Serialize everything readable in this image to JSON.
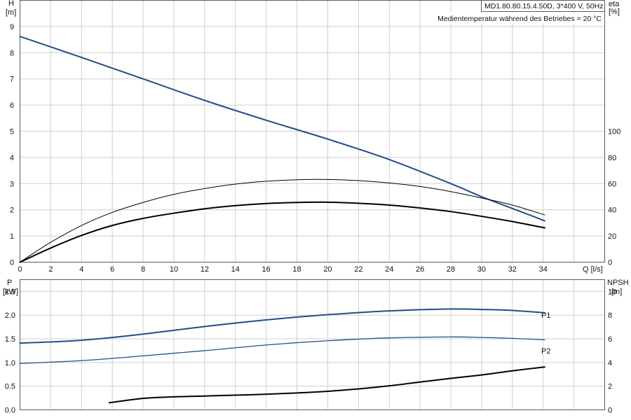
{
  "info": {
    "model_line": "MD1.80.80.15.4.50D, 3*400 V, 50Hz",
    "temp_line": "Medientemperatur während des Betriebes = 20 °C"
  },
  "colors": {
    "blue": "#1f4e8c",
    "black": "#000000",
    "grid": "#cfcfcf"
  },
  "chart_data": [
    {
      "type": "line",
      "name": "performance",
      "x_axis": {
        "label": "Q [l/s]",
        "range": [
          0,
          38
        ],
        "ticks": [
          0,
          2,
          4,
          6,
          8,
          10,
          12,
          14,
          16,
          18,
          20,
          22,
          24,
          26,
          28,
          30,
          32,
          34
        ]
      },
      "y_left": {
        "label": "H",
        "unit": "[m]",
        "range": [
          0,
          10
        ],
        "ticks": [
          0,
          1,
          2,
          3,
          4,
          5,
          6,
          7,
          8,
          9
        ]
      },
      "y_right": {
        "label": "eta",
        "unit": "[%]",
        "range": [
          0,
          200
        ],
        "ticks": [
          0,
          20,
          40,
          60,
          80,
          100
        ]
      },
      "grid": true,
      "series": [
        {
          "id": "H",
          "axis": "left",
          "color": "#1f4e8c",
          "width": 2,
          "x": [
            0,
            4,
            8,
            12,
            16,
            20,
            24,
            28,
            30,
            32,
            34.1
          ],
          "y": [
            8.62,
            7.82,
            7.0,
            6.18,
            5.42,
            4.7,
            3.92,
            3.0,
            2.5,
            2.05,
            1.58
          ]
        },
        {
          "id": "eta_thin",
          "axis": "right",
          "color": "#000000",
          "width": 1,
          "x": [
            0,
            2,
            4,
            6,
            8,
            10,
            12,
            14,
            16,
            18,
            20,
            22,
            24,
            26,
            28,
            30,
            32,
            34.1
          ],
          "y": [
            0,
            15.2,
            28,
            38,
            45.6,
            51.8,
            56.2,
            59.6,
            61.8,
            63,
            63.2,
            62.3,
            60.5,
            57.8,
            53.9,
            49,
            43.6,
            36.1
          ]
        },
        {
          "id": "eta_thick",
          "axis": "right",
          "color": "#000000",
          "width": 2,
          "x": [
            0,
            2,
            4,
            6,
            8,
            10,
            12,
            14,
            16,
            18,
            20,
            22,
            24,
            26,
            28,
            30,
            32,
            34.1
          ],
          "y": [
            0,
            10.8,
            20.4,
            28,
            33.4,
            37.4,
            40.8,
            43.2,
            44.8,
            45.6,
            45.8,
            45,
            43.6,
            41.4,
            38.6,
            35,
            31,
            26.2
          ]
        }
      ]
    },
    {
      "type": "line",
      "name": "power-npsh",
      "x_axis": {
        "range": [
          0,
          38
        ]
      },
      "y_left": {
        "label": "P",
        "unit": "[kW]",
        "range": [
          0,
          2.75
        ],
        "ticks": [
          "0.0",
          "0.5",
          "1.0",
          "1.5",
          "2.0",
          "2.5"
        ]
      },
      "y_right": {
        "label": "NPSH",
        "unit": "[m]",
        "range": [
          0,
          11
        ],
        "ticks": [
          0,
          2,
          4,
          6,
          8,
          10
        ]
      },
      "grid": true,
      "series": [
        {
          "id": "P1",
          "name": "P1",
          "axis": "left",
          "color": "#1f4e8c",
          "width": 2,
          "x": [
            0,
            4,
            8,
            12,
            16,
            20,
            24,
            28,
            30,
            32,
            34.1
          ],
          "y": [
            1.41,
            1.47,
            1.6,
            1.76,
            1.9,
            2.01,
            2.09,
            2.13,
            2.12,
            2.1,
            2.05
          ]
        },
        {
          "id": "P2",
          "name": "P2",
          "axis": "left",
          "color": "#1f4e8c",
          "width": 1.3,
          "x": [
            0,
            4,
            8,
            12,
            16,
            20,
            24,
            28,
            30,
            32,
            34.1
          ],
          "y": [
            0.98,
            1.04,
            1.14,
            1.25,
            1.37,
            1.46,
            1.52,
            1.54,
            1.53,
            1.51,
            1.48
          ]
        },
        {
          "id": "NPSH",
          "axis": "right",
          "color": "#000000",
          "width": 2,
          "x": [
            5.8,
            8,
            10,
            12,
            14,
            16,
            18,
            20,
            22,
            24,
            26,
            28,
            30,
            32,
            34.1
          ],
          "y": [
            0.6,
            0.97,
            1.1,
            1.17,
            1.24,
            1.32,
            1.43,
            1.57,
            1.77,
            2.03,
            2.35,
            2.66,
            2.95,
            3.3,
            3.62
          ]
        }
      ]
    }
  ]
}
